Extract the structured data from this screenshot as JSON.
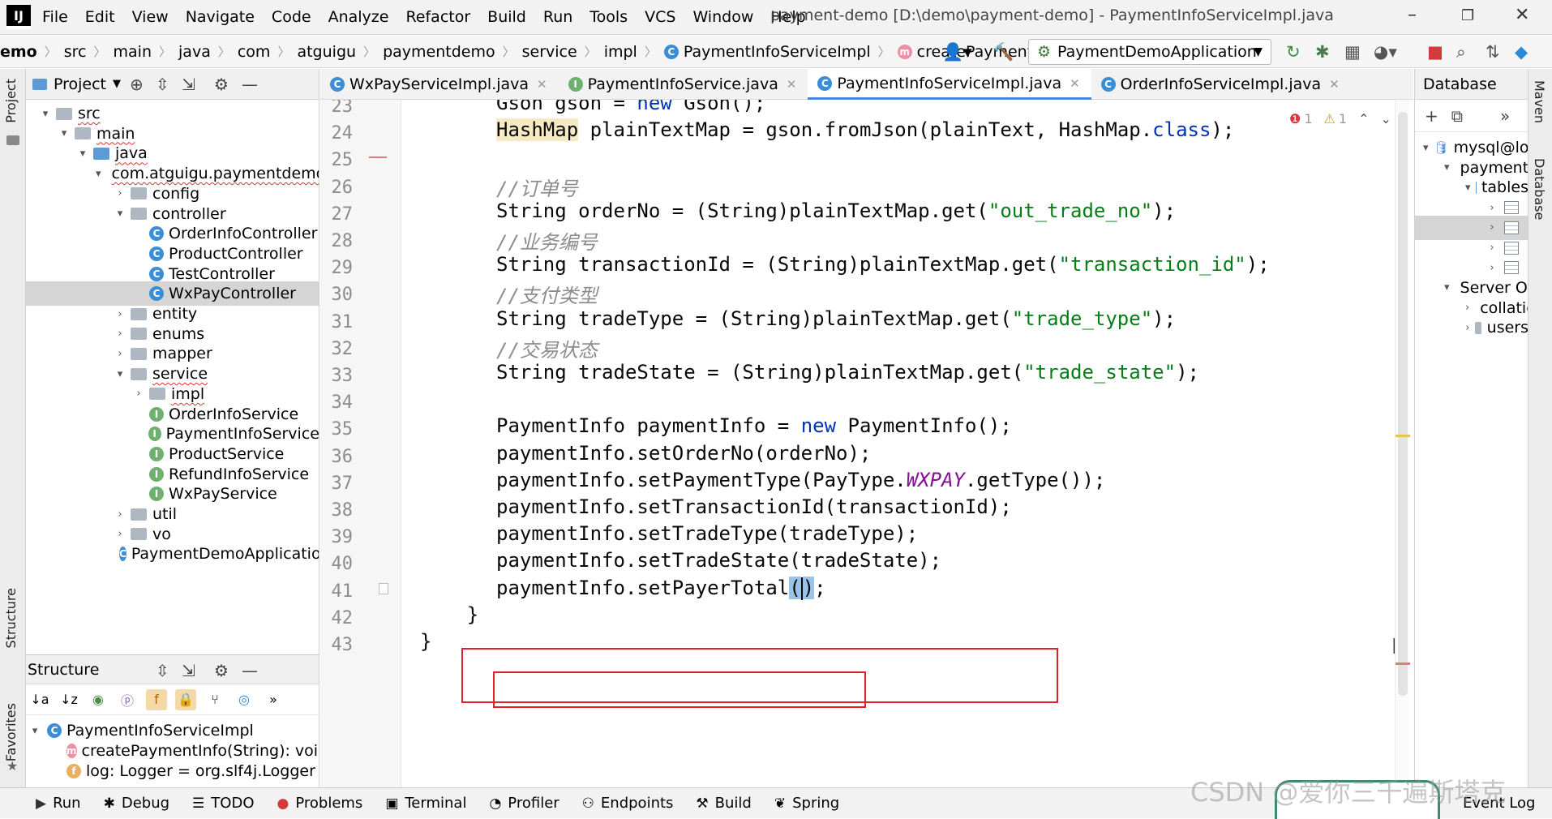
{
  "menubar": {
    "logo": "IJ",
    "items": [
      "File",
      "Edit",
      "View",
      "Navigate",
      "Code",
      "Analyze",
      "Refactor",
      "Build",
      "Run",
      "Tools",
      "VCS",
      "Window",
      "Help"
    ],
    "title": "payment-demo [D:\\demo\\payment-demo] - PaymentInfoServiceImpl.java"
  },
  "navbar": {
    "crumbs": [
      "emo",
      "src",
      "main",
      "java",
      "com",
      "atguigu",
      "paymentdemo",
      "service",
      "impl",
      "PaymentInfoServiceImpl",
      "createPaymentInfo"
    ],
    "run_config": "PaymentDemoApplication"
  },
  "project": {
    "title": "Project",
    "tree": [
      {
        "label": "src",
        "indent": 1,
        "arrow": "▾",
        "icon": "folder"
      },
      {
        "label": "main",
        "indent": 2,
        "arrow": "▾",
        "icon": "folder"
      },
      {
        "label": "java",
        "indent": 3,
        "arrow": "▾",
        "icon": "folder-blue"
      },
      {
        "label": "com.atguigu.paymentdemo",
        "indent": 4,
        "arrow": "▾",
        "icon": "folder"
      },
      {
        "label": "config",
        "indent": 5,
        "arrow": "›",
        "icon": "folder"
      },
      {
        "label": "controller",
        "indent": 5,
        "arrow": "▾",
        "icon": "folder"
      },
      {
        "label": "OrderInfoController",
        "indent": 6,
        "arrow": "",
        "icon": "class"
      },
      {
        "label": "ProductController",
        "indent": 6,
        "arrow": "",
        "icon": "class"
      },
      {
        "label": "TestController",
        "indent": 6,
        "arrow": "",
        "icon": "class"
      },
      {
        "label": "WxPayController",
        "indent": 6,
        "arrow": "",
        "icon": "class",
        "selected": true
      },
      {
        "label": "entity",
        "indent": 5,
        "arrow": "›",
        "icon": "folder"
      },
      {
        "label": "enums",
        "indent": 5,
        "arrow": "›",
        "icon": "folder"
      },
      {
        "label": "mapper",
        "indent": 5,
        "arrow": "›",
        "icon": "folder"
      },
      {
        "label": "service",
        "indent": 5,
        "arrow": "▾",
        "icon": "folder"
      },
      {
        "label": "impl",
        "indent": 6,
        "arrow": "›",
        "icon": "folder"
      },
      {
        "label": "OrderInfoService",
        "indent": 6,
        "arrow": "",
        "icon": "interface"
      },
      {
        "label": "PaymentInfoService",
        "indent": 6,
        "arrow": "",
        "icon": "interface"
      },
      {
        "label": "ProductService",
        "indent": 6,
        "arrow": "",
        "icon": "interface"
      },
      {
        "label": "RefundInfoService",
        "indent": 6,
        "arrow": "",
        "icon": "interface"
      },
      {
        "label": "WxPayService",
        "indent": 6,
        "arrow": "",
        "icon": "interface"
      },
      {
        "label": "util",
        "indent": 5,
        "arrow": "›",
        "icon": "folder"
      },
      {
        "label": "vo",
        "indent": 5,
        "arrow": "›",
        "icon": "folder"
      },
      {
        "label": "PaymentDemoApplication",
        "indent": 5,
        "arrow": "",
        "icon": "class"
      }
    ]
  },
  "structure": {
    "title": "Structure",
    "items": [
      {
        "label": "PaymentInfoServiceImpl",
        "icon": "class",
        "indent": 0
      },
      {
        "label": "createPaymentInfo(String): void",
        "icon": "method",
        "indent": 1
      },
      {
        "label": "log: Logger = org.slf4j.Logger",
        "icon": "field",
        "indent": 1
      }
    ]
  },
  "editor": {
    "tabs": [
      {
        "label": "WxPayServiceImpl.java",
        "icon": "C",
        "active": false
      },
      {
        "label": "PaymentInfoService.java",
        "icon": "I",
        "active": false
      },
      {
        "label": "PaymentInfoServiceImpl.java",
        "icon": "C",
        "active": true
      },
      {
        "label": "OrderInfoServiceImpl.java",
        "icon": "C",
        "active": false
      }
    ],
    "inspections": {
      "errors": "1",
      "warnings": "1"
    },
    "lines": [
      {
        "n": "23",
        "indent": 1,
        "tokens": [
          [
            "n",
            "Gson gson = "
          ],
          [
            "kw",
            "new"
          ],
          [
            "n",
            " Gson();"
          ]
        ]
      },
      {
        "n": "24",
        "indent": 1,
        "tokens": [
          [
            "hl",
            "HashMap"
          ],
          [
            "n",
            " plainTextMap = gson.fromJson(plainText, HashMap."
          ],
          [
            "kw",
            "class"
          ],
          [
            "n",
            ");"
          ]
        ]
      },
      {
        "n": "25",
        "indent": 0,
        "tokens": []
      },
      {
        "n": "26",
        "indent": 1,
        "tokens": [
          [
            "cmt",
            "//订单号"
          ]
        ]
      },
      {
        "n": "27",
        "indent": 1,
        "tokens": [
          [
            "n",
            "String orderNo = (String)plainTextMap.get("
          ],
          [
            "str",
            "\"out_trade_no\""
          ],
          [
            "n",
            ");"
          ]
        ]
      },
      {
        "n": "28",
        "indent": 1,
        "tokens": [
          [
            "cmt",
            "//业务编号"
          ]
        ]
      },
      {
        "n": "29",
        "indent": 1,
        "tokens": [
          [
            "n",
            "String transactionId = (String)plainTextMap.get("
          ],
          [
            "str",
            "\"transaction_id\""
          ],
          [
            "n",
            ");"
          ]
        ]
      },
      {
        "n": "30",
        "indent": 1,
        "tokens": [
          [
            "cmt",
            "//支付类型"
          ]
        ]
      },
      {
        "n": "31",
        "indent": 1,
        "tokens": [
          [
            "n",
            "String tradeType = (String)plainTextMap.get("
          ],
          [
            "str",
            "\"trade_type\""
          ],
          [
            "n",
            ");"
          ]
        ]
      },
      {
        "n": "32",
        "indent": 1,
        "tokens": [
          [
            "cmt",
            "//交易状态"
          ]
        ]
      },
      {
        "n": "33",
        "indent": 1,
        "tokens": [
          [
            "n",
            "String tradeState = (String)plainTextMap.get("
          ],
          [
            "str",
            "\"trade_state\""
          ],
          [
            "n",
            ");"
          ]
        ]
      },
      {
        "n": "34",
        "indent": 0,
        "tokens": []
      },
      {
        "n": "35",
        "indent": 1,
        "tokens": [
          [
            "n",
            "PaymentInfo paymentInfo = "
          ],
          [
            "kw",
            "new"
          ],
          [
            "n",
            " PaymentInfo();"
          ]
        ]
      },
      {
        "n": "36",
        "indent": 1,
        "tokens": [
          [
            "n",
            "paymentInfo.setOrderNo(orderNo);"
          ]
        ]
      },
      {
        "n": "37",
        "indent": 1,
        "tokens": [
          [
            "n",
            "paymentInfo.setPaymentType(PayType."
          ],
          [
            "enm",
            "WXPAY"
          ],
          [
            "n",
            ".getType());"
          ]
        ]
      },
      {
        "n": "38",
        "indent": 1,
        "tokens": [
          [
            "n",
            "paymentInfo.setTransactionId(transactionId);"
          ]
        ]
      },
      {
        "n": "39",
        "indent": 1,
        "tokens": [
          [
            "n",
            "paymentInfo.setTradeType(tradeType);"
          ]
        ]
      },
      {
        "n": "40",
        "indent": 1,
        "tokens": [
          [
            "n",
            "paymentInfo.setTradeState(tradeState);"
          ]
        ]
      },
      {
        "n": "41",
        "indent": 1,
        "tokens": [
          [
            "n",
            "paymentInfo.setPayerTotal"
          ],
          [
            "caret",
            "("
          ],
          [
            "caret2",
            ")"
          ],
          [
            "n",
            ";"
          ]
        ]
      },
      {
        "n": "42",
        "indent": 0,
        "tokens": [
          [
            "n",
            "    }"
          ]
        ]
      },
      {
        "n": "43",
        "indent": 0,
        "tokens": [
          [
            "n",
            "}"
          ]
        ]
      }
    ]
  },
  "database": {
    "title": "Database",
    "tree": [
      {
        "label": "mysql@localhost",
        "indent": 0,
        "arrow": "▾",
        "icon": "db"
      },
      {
        "label": "payment_demo",
        "indent": 1,
        "arrow": "▾",
        "icon": "schema"
      },
      {
        "label": "tables",
        "indent": 2,
        "arrow": "▾",
        "icon": "folder-blue"
      },
      {
        "label": "",
        "indent": 3,
        "arrow": "›",
        "icon": "table"
      },
      {
        "label": "",
        "indent": 3,
        "arrow": "›",
        "icon": "table",
        "selected": true
      },
      {
        "label": "",
        "indent": 3,
        "arrow": "›",
        "icon": "table"
      },
      {
        "label": "",
        "indent": 3,
        "arrow": "›",
        "icon": "table"
      },
      {
        "label": "Server Objects",
        "indent": 1,
        "arrow": "▾",
        "icon": "folder"
      },
      {
        "label": "collations",
        "indent": 2,
        "arrow": "›",
        "icon": "folder"
      },
      {
        "label": "users",
        "indent": 2,
        "arrow": "›",
        "icon": "folder"
      }
    ]
  },
  "left_strip": {
    "top": "Project",
    "middle": "Structure",
    "bottom": "Favorites"
  },
  "right_strip": {
    "top": "Maven",
    "middle": "Database"
  },
  "bottombar": {
    "items": [
      {
        "label": "Run",
        "icon": "▶"
      },
      {
        "label": "Debug",
        "icon": "✱"
      },
      {
        "label": "TODO",
        "icon": "☰"
      },
      {
        "label": "Problems",
        "icon": "●"
      },
      {
        "label": "Terminal",
        "icon": "▣"
      },
      {
        "label": "Profiler",
        "icon": "◔"
      },
      {
        "label": "Endpoints",
        "icon": "⚇"
      },
      {
        "label": "Build",
        "icon": "⚒"
      },
      {
        "label": "Spring",
        "icon": "❦"
      }
    ],
    "event_log": "Event Log"
  },
  "watermark": "CSDN @爱你三千遍斯塔克",
  "colors": {
    "keyword": "#0033b3",
    "string": "#067d17",
    "comment": "#8c8c8c",
    "enum": "#871094",
    "annotation_box": "#e0202a"
  }
}
